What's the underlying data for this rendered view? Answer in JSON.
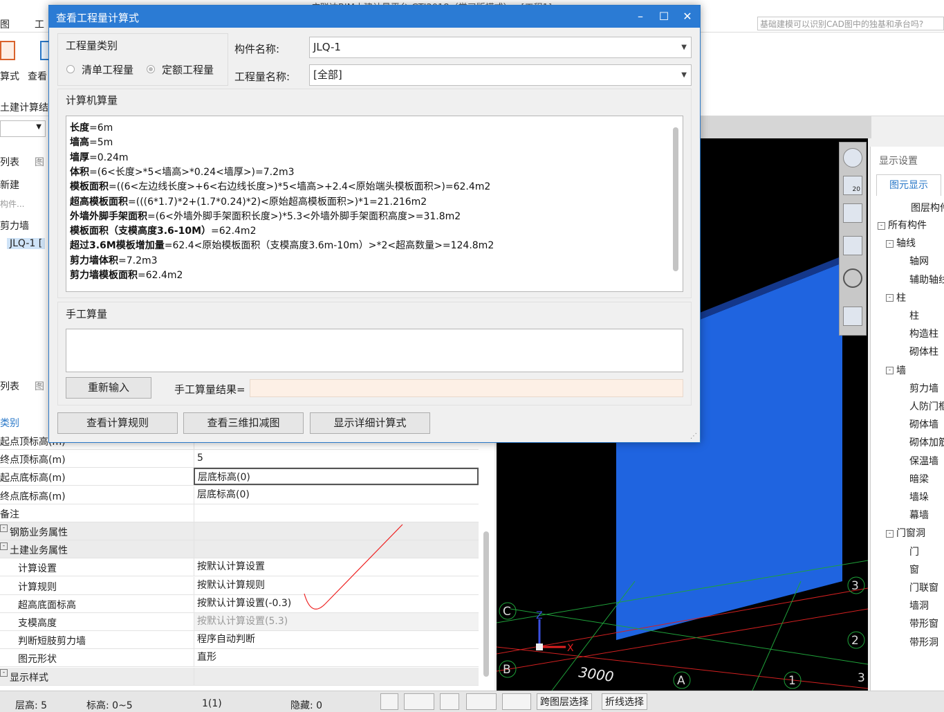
{
  "app": {
    "title_partial": "广联达BIM土建计量平台 GTJ2018（学习版模式） - [工程1]",
    "tabs": [
      "图",
      "工"
    ],
    "search_placeholder": "基础建模可以识别CAD图中的独基和承台吗?",
    "ribbon_buttons": [
      "算式",
      "查看"
    ],
    "group_label": "土建计算结果"
  },
  "left_panel": {
    "tab_list_1": "列表",
    "tab_layer_1": "图",
    "new_label": "新建",
    "search_placeholder": "构件...",
    "tree_node": "剪力墙",
    "tree_child": "JLQ-1 [",
    "tab_list_2": "列表",
    "tab_layer_2": "图",
    "header_label": "类别",
    "rows": [
      {
        "key": "起点顶标高(m)",
        "value": "5",
        "group": false
      },
      {
        "key": "终点顶标高(m)",
        "value": "5",
        "group": false
      },
      {
        "key": "起点底标高(m)",
        "value": "层底标高(0)",
        "group": false
      },
      {
        "key": "终点底标高(m)",
        "value": "层底标高(0)",
        "group": false
      },
      {
        "key": "备注",
        "value": "",
        "group": false
      },
      {
        "key": "钢筋业务属性",
        "value": "",
        "group": true
      },
      {
        "key": "土建业务属性",
        "value": "",
        "group": true
      },
      {
        "key": "计算设置",
        "value": "按默认计算设置",
        "group": false
      },
      {
        "key": "计算规则",
        "value": "按默认计算规则",
        "group": false
      },
      {
        "key": "超高底面标高",
        "value": "按默认计算设置(-0.3)",
        "group": false
      },
      {
        "key": "支模高度",
        "value": "按默认计算设置(5.3)",
        "group": false
      },
      {
        "key": "判断短肢剪力墙",
        "value": "程序自动判断",
        "group": false
      },
      {
        "key": "图元形状",
        "value": "直形",
        "group": false
      },
      {
        "key": "显示样式",
        "value": "",
        "group": true
      }
    ]
  },
  "viewport": {
    "axis_labels": [
      "C",
      "B",
      "A",
      "1",
      "2",
      "3",
      "3",
      "3"
    ],
    "dimension_text": "3000",
    "zoom_badge": "20",
    "axis_x": "X",
    "axis_z": "Z",
    "colors": {
      "wall": "#1f64e0",
      "grid_red": "#d42020",
      "grid_green": "#1fa23a"
    }
  },
  "right_panel": {
    "title": "显示设置",
    "tab": "图元显示",
    "column_header": "图层构件",
    "tree": [
      {
        "label": "所有构件",
        "level": 0,
        "expander": true
      },
      {
        "label": "轴线",
        "level": 1,
        "expander": true
      },
      {
        "label": "轴网",
        "level": 2,
        "expander": false
      },
      {
        "label": "辅助轴线",
        "level": 2,
        "expander": false
      },
      {
        "label": "柱",
        "level": 1,
        "expander": true
      },
      {
        "label": "柱",
        "level": 2,
        "expander": false
      },
      {
        "label": "构造柱",
        "level": 2,
        "expander": false
      },
      {
        "label": "砌体柱",
        "level": 2,
        "expander": false
      },
      {
        "label": "墙",
        "level": 1,
        "expander": true
      },
      {
        "label": "剪力墙",
        "level": 2,
        "expander": false
      },
      {
        "label": "人防门框墙",
        "level": 2,
        "expander": false
      },
      {
        "label": "砌体墙",
        "level": 2,
        "expander": false
      },
      {
        "label": "砌体加筋",
        "level": 2,
        "expander": false
      },
      {
        "label": "保温墙",
        "level": 2,
        "expander": false
      },
      {
        "label": "暗梁",
        "level": 2,
        "expander": false
      },
      {
        "label": "墙垛",
        "level": 2,
        "expander": false
      },
      {
        "label": "幕墙",
        "level": 2,
        "expander": false
      },
      {
        "label": "门窗洞",
        "level": 1,
        "expander": true
      },
      {
        "label": "门",
        "level": 2,
        "expander": false
      },
      {
        "label": "窗",
        "level": 2,
        "expander": false
      },
      {
        "label": "门联窗",
        "level": 2,
        "expander": false
      },
      {
        "label": "墙洞",
        "level": 2,
        "expander": false
      },
      {
        "label": "带形窗",
        "level": 2,
        "expander": false
      },
      {
        "label": "带形洞",
        "level": 2,
        "expander": false
      }
    ]
  },
  "statusbar": {
    "floor": "层高:  5",
    "elevation": "标高:  0~5",
    "count": "1(1)",
    "hidden": "隐藏:  0",
    "cross_floor_select": "跨图层选择",
    "polyline_select": "折线选择"
  },
  "dialog": {
    "title": "查看工程量计算式",
    "qty_type_legend": "工程量类别",
    "radio_bill": "清单工程量",
    "radio_quota": "定额工程量",
    "selected_radio": "定额工程量",
    "component_label": "构件名称:",
    "component_value": "JLQ-1",
    "qty_name_label": "工程量名称:",
    "qty_name_value": "[全部]",
    "computer_calc_legend": "计算机算量",
    "calc_lines": [
      {
        "bold": "长度",
        "rest": "=6m"
      },
      {
        "bold": "墙高",
        "rest": "=5m"
      },
      {
        "bold": "墙厚",
        "rest": "=0.24m"
      },
      {
        "bold": "体积",
        "rest": "=(6<长度>*5<墙高>*0.24<墙厚>)=7.2m3"
      },
      {
        "bold": "模板面积",
        "rest": "=((6<左边线长度>+6<右边线长度>)*5<墙高>+2.4<原始端头模板面积>)=62.4m2"
      },
      {
        "bold": "超高模板面积",
        "rest": "=(((6*1.7)*2+(1.7*0.24)*2)<原始超高模板面积>)*1=21.216m2"
      },
      {
        "bold": "外墙外脚手架面积",
        "rest": "=(6<外墙外脚手架面积长度>)*5.3<外墙外脚手架面积高度>=31.8m2"
      },
      {
        "bold": "模板面积（支模高度3.6-10M）",
        "rest": "=62.4m2"
      },
      {
        "bold": "超过3.6M模板增加量",
        "rest": "=62.4<原始模板面积（支模高度3.6m-10m）>*2<超高数量>=124.8m2"
      },
      {
        "bold": "剪力墙体积",
        "rest": "=7.2m3"
      },
      {
        "bold": "剪力墙模板面积",
        "rest": "=62.4m2"
      }
    ],
    "manual_calc_legend": "手工算量",
    "manual_input": "",
    "reenter_button": "重新输入",
    "manual_result_label": "手工算量结果=",
    "manual_result_value": "",
    "view_rules_button": "查看计算规则",
    "view_3d_button": "查看三维扣减图",
    "show_detail_button": "显示详细计算式"
  }
}
